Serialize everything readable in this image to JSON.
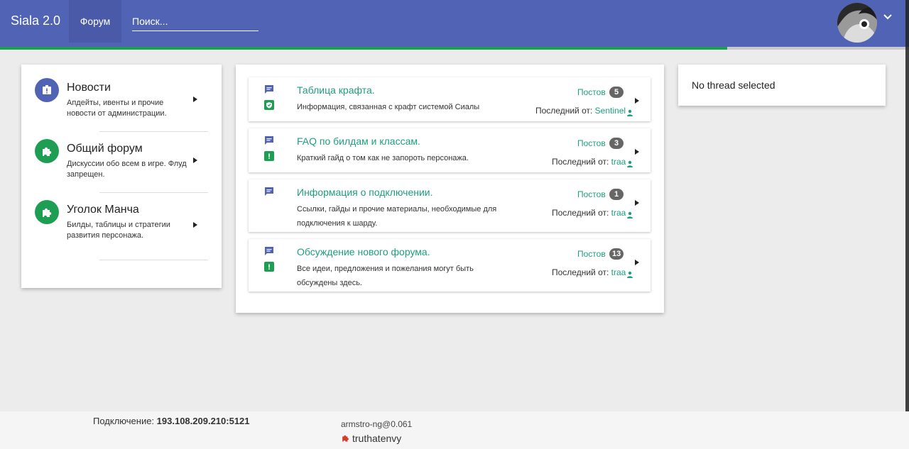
{
  "header": {
    "brand": "Siala 2.0",
    "nav_tab": "Форум",
    "search_placeholder": "Поиск...",
    "progress": 0.8
  },
  "categories": [
    {
      "title": "Новости",
      "description": "Апдейты, ивенты и прочие новости от администрации.",
      "icon": "report-icon",
      "icon_color": "#5163b5"
    },
    {
      "title": "Общий форум",
      "description": "Дискуссии обо всем в игре. Флуд запрещен.",
      "icon": "puzzle-icon",
      "icon_color": "#1e9e52"
    },
    {
      "title": "Уголок Манча",
      "description": "Билды, таблицы и стратегии развития персонажа.",
      "icon": "puzzle-icon",
      "icon_color": "#1e9e52"
    }
  ],
  "threads": [
    {
      "title": "Таблица крафта.",
      "description": "Информация, связанная с крафт системой Сиалы",
      "posts_label": "Постов",
      "posts": "5",
      "last_label": "Последний от:",
      "author": "Sentinel",
      "tag": "shield-check-icon"
    },
    {
      "title": "FAQ по билдам и классам.",
      "description": "Краткий гайд о том как не запороть персонажа.",
      "posts_label": "Постов",
      "posts": "3",
      "last_label": "Последний от:",
      "author": "traa",
      "tag": "exclamation-icon"
    },
    {
      "title": "Информация о подключении.",
      "description": "Ссылки, гайды и прочие материалы, необходимые для подключения к шарду.",
      "posts_label": "Постов",
      "posts": "1",
      "last_label": "Последний от:",
      "author": "traa",
      "tag": ""
    },
    {
      "title": "Обсуждение нового форума.",
      "description": "Все идеи, предложения и пожелания могут быть обсуждены здесь.",
      "posts_label": "Постов",
      "posts": "13",
      "last_label": "Последний от:",
      "author": "traa",
      "tag": "exclamation-icon"
    }
  ],
  "detail": {
    "empty_text": "No thread selected"
  },
  "footer": {
    "connection_label": "Подключение:",
    "connection_value": "193.108.209.210:5121",
    "build": "armstro-ng@0.061",
    "username": "truthatenvy"
  },
  "colors": {
    "header": "#5163b5",
    "accent": "#1e9e80",
    "green": "#1e9e52"
  }
}
